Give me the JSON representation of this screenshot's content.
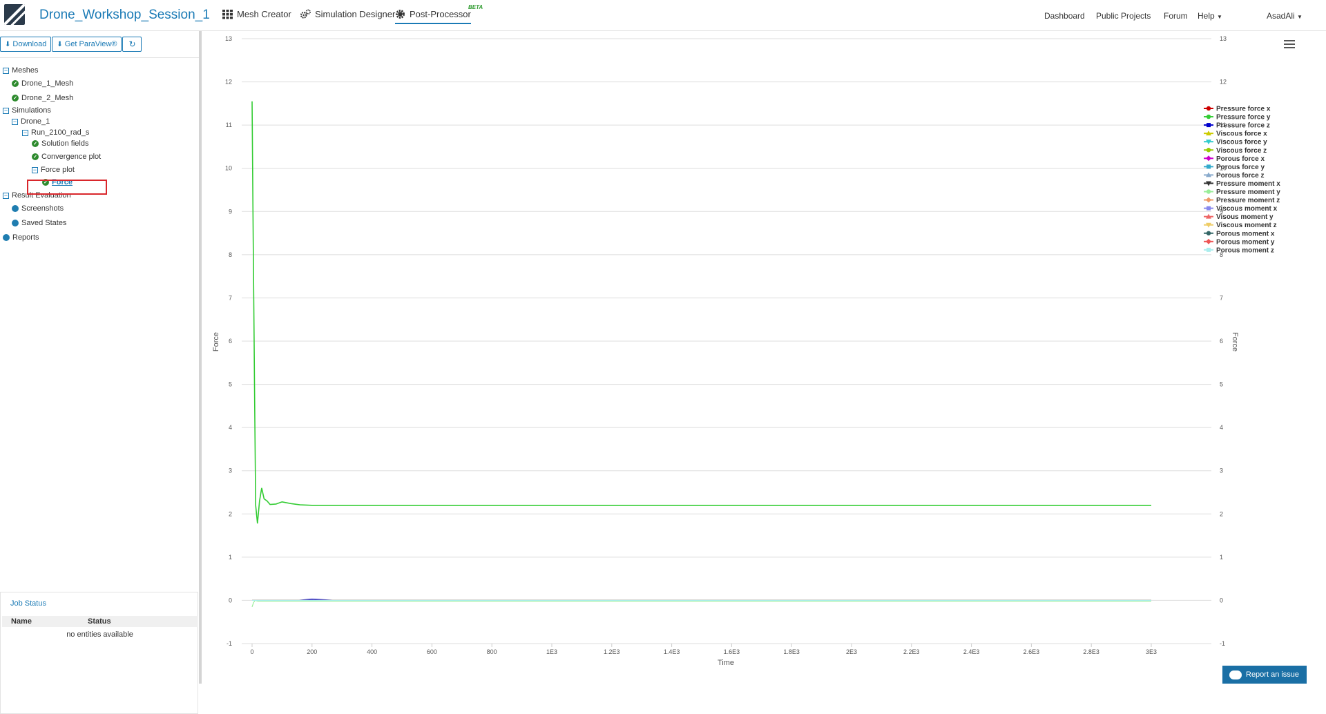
{
  "header": {
    "project_title": "Drone_Workshop_Session_1",
    "tabs": [
      {
        "label": "Mesh Creator",
        "icon": "grid-icon"
      },
      {
        "label": "Simulation Designer",
        "icon": "gears-icon"
      },
      {
        "label": "Post-Processor",
        "icon": "gear-icon",
        "active": true
      }
    ],
    "beta_label": "BETA",
    "right_links": [
      "Dashboard",
      "Public Projects",
      "Forum",
      "Help"
    ],
    "user": "AsadAli"
  },
  "toolbar": {
    "download_label": "Download",
    "paraview_label": "Get ParaView®",
    "refresh_icon": "refresh-icon"
  },
  "tree": {
    "meshes": "Meshes",
    "mesh1": "Drone_1_Mesh",
    "mesh2": "Drone_2_Mesh",
    "simulations": "Simulations",
    "drone1": "Drone_1",
    "run": "Run_2100_rad_s",
    "solution_fields": "Solution fields",
    "convergence_plot": "Convergence plot",
    "force_plot": "Force plot",
    "force": "Force",
    "result_evaluation": "Result Evaluation",
    "screenshots": "Screenshots",
    "saved_states": "Saved States",
    "reports": "Reports"
  },
  "job_status": {
    "title": "Job Status",
    "col_name": "Name",
    "col_status": "Status",
    "empty": "no entities available"
  },
  "report_issue": "Report an issue",
  "chart_data": {
    "type": "line",
    "title": "",
    "xlabel": "Time",
    "ylabel": "Force",
    "y2label": "Force",
    "xlim": [
      0,
      3000
    ],
    "ylim": [
      -1,
      13
    ],
    "x_ticks": [
      "0",
      "200",
      "400",
      "600",
      "800",
      "1E3",
      "1.2E3",
      "1.4E3",
      "1.6E3",
      "1.8E3",
      "2E3",
      "2.2E3",
      "2.4E3",
      "2.6E3",
      "2.8E3",
      "3E3"
    ],
    "x_tick_values": [
      0,
      200,
      400,
      600,
      800,
      1000,
      1200,
      1400,
      1600,
      1800,
      2000,
      2200,
      2400,
      2600,
      2800,
      3000
    ],
    "y_ticks": [
      -1,
      0,
      1,
      2,
      3,
      4,
      5,
      6,
      7,
      8,
      9,
      10,
      11,
      12,
      13
    ],
    "grid": true,
    "legend_position": "top-right",
    "series": [
      {
        "name": "Pressure force x",
        "color": "#cc0000",
        "marker": "circle",
        "x": [
          0,
          3000
        ],
        "y": [
          0,
          0
        ]
      },
      {
        "name": "Pressure force y",
        "color": "#33cc33",
        "marker": "circle",
        "x": [
          0,
          3,
          8,
          12,
          18,
          25,
          32,
          40,
          50,
          60,
          80,
          100,
          130,
          160,
          200,
          300,
          600,
          1000,
          2000,
          3000
        ],
        "y": [
          11.55,
          9.0,
          5.0,
          2.2,
          1.78,
          2.3,
          2.6,
          2.35,
          2.3,
          2.22,
          2.23,
          2.28,
          2.24,
          2.21,
          2.2,
          2.2,
          2.2,
          2.2,
          2.2,
          2.2
        ]
      },
      {
        "name": "Pressure force z",
        "color": "#0000cc",
        "marker": "square",
        "x": [
          0,
          150,
          200,
          280,
          3000
        ],
        "y": [
          0,
          0,
          0.03,
          0,
          0
        ]
      },
      {
        "name": "Viscous force x",
        "color": "#cccc00",
        "marker": "triangle",
        "x": [
          0,
          3000
        ],
        "y": [
          0,
          0
        ]
      },
      {
        "name": "Viscous force y",
        "color": "#33cccc",
        "marker": "triangle-down",
        "x": [
          0,
          3000
        ],
        "y": [
          0,
          0
        ]
      },
      {
        "name": "Viscous force z",
        "color": "#99cc00",
        "marker": "circle",
        "x": [
          0,
          3000
        ],
        "y": [
          0,
          0
        ]
      },
      {
        "name": "Porous force x",
        "color": "#cc00cc",
        "marker": "diamond",
        "x": [
          0,
          3000
        ],
        "y": [
          0,
          0
        ]
      },
      {
        "name": "Porous force y",
        "color": "#33aacc",
        "marker": "square",
        "x": [
          0,
          3000
        ],
        "y": [
          0,
          0
        ]
      },
      {
        "name": "Porous force z",
        "color": "#88aacc",
        "marker": "triangle",
        "x": [
          0,
          3000
        ],
        "y": [
          0,
          0
        ]
      },
      {
        "name": "Pressure moment x",
        "color": "#333333",
        "marker": "triangle-down",
        "x": [
          0,
          3000
        ],
        "y": [
          0,
          0
        ]
      },
      {
        "name": "Pressure moment y",
        "color": "#99ee99",
        "marker": "circle",
        "x": [
          0,
          5,
          10,
          20,
          3000
        ],
        "y": [
          -0.15,
          -0.05,
          0.0,
          -0.02,
          -0.02
        ]
      },
      {
        "name": "Pressure moment z",
        "color": "#ee9966",
        "marker": "diamond",
        "x": [
          0,
          3000
        ],
        "y": [
          0,
          0
        ]
      },
      {
        "name": "Viscous moment x",
        "color": "#8888ee",
        "marker": "square",
        "x": [
          0,
          3000
        ],
        "y": [
          0,
          0
        ]
      },
      {
        "name": "Visous moment y",
        "color": "#ee6666",
        "marker": "triangle",
        "x": [
          0,
          3000
        ],
        "y": [
          0,
          0
        ]
      },
      {
        "name": "Viscous moment z",
        "color": "#eecc66",
        "marker": "triangle-down",
        "x": [
          0,
          3000
        ],
        "y": [
          0,
          0
        ]
      },
      {
        "name": "Porous moment x",
        "color": "#336666",
        "marker": "circle",
        "x": [
          0,
          3000
        ],
        "y": [
          0,
          0
        ]
      },
      {
        "name": "Porous moment y",
        "color": "#ee5555",
        "marker": "diamond",
        "x": [
          0,
          3000
        ],
        "y": [
          0,
          0
        ]
      },
      {
        "name": "Porous moment z",
        "color": "#aaeeee",
        "marker": "square",
        "x": [
          0,
          3000
        ],
        "y": [
          0,
          0
        ]
      }
    ]
  }
}
